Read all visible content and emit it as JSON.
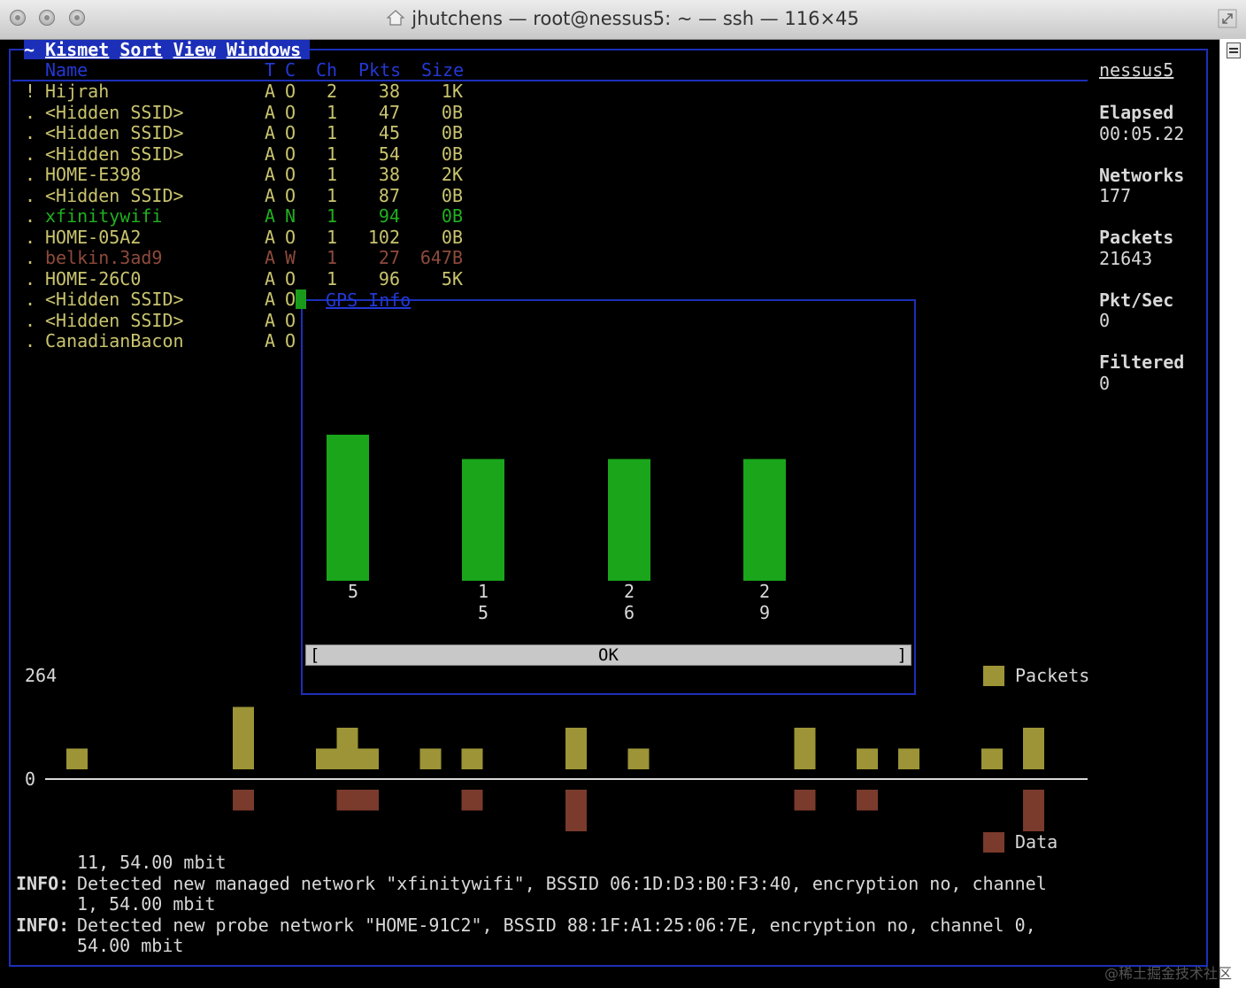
{
  "window": {
    "title": "jhutchens — root@nessus5: ~ — ssh — 116×45"
  },
  "menu": {
    "tilde": "~",
    "items": [
      "Kismet",
      "Sort",
      "View",
      "Windows"
    ]
  },
  "table": {
    "headers": {
      "name": "Name",
      "t": "T",
      "c": "C",
      "ch": "Ch",
      "pkts": "Pkts",
      "size": "Size"
    },
    "rows": [
      {
        "flag": "!",
        "name": "Hijrah",
        "t": "A",
        "c": "O",
        "ch": "2",
        "pkts": "38",
        "size": "1K",
        "color": "#c9c46e",
        "bold": false
      },
      {
        "flag": ".",
        "name": "<Hidden SSID>",
        "t": "A",
        "c": "O",
        "ch": "1",
        "pkts": "47",
        "size": "0B",
        "color": "#c9c46e",
        "bold": false
      },
      {
        "flag": ".",
        "name": "<Hidden SSID>",
        "t": "A",
        "c": "O",
        "ch": "1",
        "pkts": "45",
        "size": "0B",
        "color": "#c9c46e",
        "bold": false
      },
      {
        "flag": ".",
        "name": "<Hidden SSID>",
        "t": "A",
        "c": "O",
        "ch": "1",
        "pkts": "54",
        "size": "0B",
        "color": "#c9c46e",
        "bold": false
      },
      {
        "flag": ".",
        "name": "HOME-E398",
        "t": "A",
        "c": "O",
        "ch": "1",
        "pkts": "38",
        "size": "2K",
        "color": "#c9c46e",
        "bold": false
      },
      {
        "flag": ".",
        "name": "<Hidden SSID>",
        "t": "A",
        "c": "O",
        "ch": "1",
        "pkts": "87",
        "size": "0B",
        "color": "#c9c46e",
        "bold": false
      },
      {
        "flag": ".",
        "name": "xfinitywifi",
        "t": "A",
        "c": "N",
        "ch": "1",
        "pkts": "94",
        "size": "0B",
        "color": "#20b020",
        "bold": false
      },
      {
        "flag": ".",
        "name": "HOME-05A2",
        "t": "A",
        "c": "O",
        "ch": "1",
        "pkts": "102",
        "size": "0B",
        "color": "#c9c46e",
        "bold": false
      },
      {
        "flag": ".",
        "name": "belkin.3ad9",
        "t": "A",
        "c": "W",
        "ch": "1",
        "pkts": "27",
        "size": "647B",
        "color": "#8e4a3c",
        "bold": false
      },
      {
        "flag": ".",
        "name": "HOME-26C0",
        "t": "A",
        "c": "O",
        "ch": "1",
        "pkts": "96",
        "size": "5K",
        "color": "#c9c46e",
        "bold": false
      },
      {
        "flag": ".",
        "name": "<Hidden SSID>",
        "t": "A",
        "c": "O",
        "ch": "",
        "pkts": "",
        "size": "",
        "color": "#c9c46e",
        "bold": false
      },
      {
        "flag": ".",
        "name": "<Hidden SSID>",
        "t": "A",
        "c": "O",
        "ch": "",
        "pkts": "",
        "size": "",
        "color": "#c9c46e",
        "bold": false
      },
      {
        "flag": ".",
        "name": "CanadianBacon",
        "t": "A",
        "c": "O",
        "ch": "",
        "pkts": "",
        "size": "",
        "color": "#c9c46e",
        "bold": false
      }
    ]
  },
  "sidebar": {
    "host": "nessus5",
    "stats": [
      {
        "label": "Elapsed",
        "value": "00:05.22"
      },
      {
        "label": "Networks",
        "value": "177"
      },
      {
        "label": "Packets",
        "value": "21643"
      },
      {
        "label": "Pkt/Sec",
        "value": "0"
      },
      {
        "label": "Filtered",
        "value": "0"
      }
    ]
  },
  "popup": {
    "title": "GPS Info",
    "ok_label": "OK",
    "bracket_left": "[",
    "bracket_right": "]",
    "bar_color": "#1aa51a",
    "bars": [
      {
        "value": 6,
        "label_lines": [
          "5"
        ]
      },
      {
        "value": 5,
        "label_lines": [
          "1",
          "5"
        ]
      },
      {
        "value": 5,
        "label_lines": [
          "2",
          "6"
        ]
      },
      {
        "value": 5,
        "label_lines": [
          "2",
          "9"
        ]
      }
    ]
  },
  "packet_graph": {
    "ymax_label": "264",
    "zero_label": "0",
    "legend_packets": "Packets",
    "legend_data": "Data",
    "packets_color": "#9c9436",
    "data_color": "#7a3a2c"
  },
  "chart_data": {
    "type": "bar",
    "title": "",
    "ylim_label": "264",
    "series": [
      {
        "name": "Packets",
        "values": [
          1,
          0,
          0,
          0,
          0,
          0,
          0,
          0,
          3,
          0,
          0,
          0,
          1,
          2,
          1,
          0,
          0,
          1,
          0,
          1,
          0,
          0,
          0,
          0,
          2,
          0,
          0,
          1,
          0,
          0,
          0,
          0,
          0,
          0,
          0,
          2,
          0,
          0,
          1,
          0,
          1,
          0,
          0,
          0,
          1,
          0,
          2
        ]
      },
      {
        "name": "Data",
        "values": [
          0,
          0,
          0,
          0,
          0,
          0,
          0,
          0,
          1,
          0,
          0,
          0,
          0,
          1,
          1,
          0,
          0,
          0,
          0,
          1,
          0,
          0,
          0,
          0,
          2,
          0,
          0,
          0,
          0,
          0,
          0,
          0,
          0,
          0,
          0,
          1,
          0,
          0,
          1,
          0,
          0,
          0,
          0,
          0,
          0,
          0,
          2
        ]
      }
    ]
  },
  "log": {
    "lines": [
      {
        "tag": "",
        "text": "11, 54.00 mbit"
      },
      {
        "tag": "INFO:",
        "text": "Detected new managed network \"xfinitywifi\", BSSID 06:1D:D3:B0:F3:40, encryption no, channel"
      },
      {
        "tag": "",
        "text": "1, 54.00 mbit"
      },
      {
        "tag": "INFO:",
        "text": "Detected new probe network \"HOME-91C2\", BSSID 88:1F:A1:25:06:7E, encryption no, channel 0,"
      },
      {
        "tag": "",
        "text": "54.00 mbit"
      }
    ]
  },
  "watermark": "@稀土掘金技术社区"
}
